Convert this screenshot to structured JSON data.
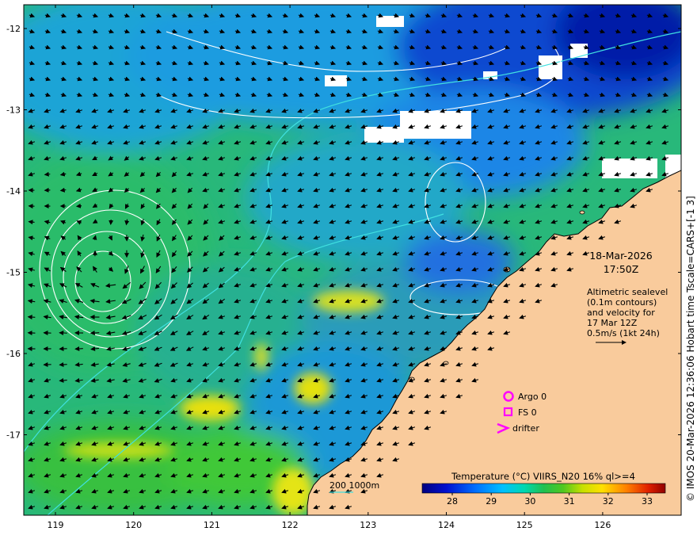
{
  "map": {
    "date": "18-Mar-2026",
    "time": "17:50Z",
    "lon_ticks": [
      "119",
      "120",
      "121",
      "122",
      "123",
      "124",
      "125",
      "126"
    ],
    "lat_ticks": [
      "-12",
      "-13",
      "-14",
      "-15",
      "-16",
      "-17"
    ],
    "info_lines": [
      "Altimetric sealevel",
      "(0.1m contours)",
      "and velocity for",
      "17 Mar 12Z",
      "0.5m/s (1kt 24h)"
    ],
    "legend": {
      "argo": "Argo 0",
      "fs": "FS 0",
      "drifter": "drifter"
    },
    "bathy_label": "200  1000m",
    "colorbar": {
      "title": "Temperature (°C) VIIRS_N20 16% ql>=4",
      "ticks": [
        "28",
        "29",
        "30",
        "31",
        "32",
        "33"
      ]
    },
    "credit": "© IMOS 20-Mar-2026 12:36:06 Hobart time Tscale=CARS+[-1 3]",
    "colors": {
      "land": "#f9cb9c",
      "cloud": "#ffffff",
      "contour": "#ffffff",
      "bathymetry": "#40e0e0",
      "marker": "#ff00ff",
      "arrow": "#000000"
    }
  }
}
